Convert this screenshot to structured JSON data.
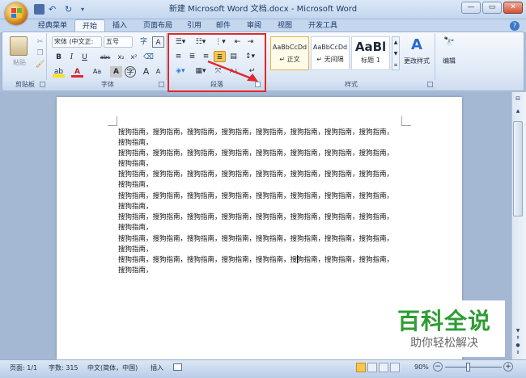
{
  "window": {
    "title": "新建 Microsoft Word 文档.docx - Microsoft Word",
    "minimize": "—",
    "maximize": "▭",
    "close": "✕"
  },
  "tabs": [
    "经典菜单",
    "开始",
    "插入",
    "页面布局",
    "引用",
    "邮件",
    "审阅",
    "视图",
    "开发工具"
  ],
  "active_tab": "开始",
  "ribbon": {
    "clipboard": {
      "paste_label": "粘贴",
      "group_label": "剪贴板"
    },
    "font": {
      "font_name": "宋体 (中文正:",
      "font_size": "五号",
      "group_label": "字体",
      "bold": "B",
      "italic": "I",
      "underline": "U",
      "strike": "abc",
      "subscript": "x₂",
      "superscript": "x²",
      "aa": "Aa",
      "grow": "A",
      "shrink": "A"
    },
    "paragraph": {
      "group_label": "段落"
    },
    "styles": {
      "group_label": "样式",
      "items": [
        {
          "preview": "AaBbCcDd",
          "name": "↵ 正文"
        },
        {
          "preview": "AaBbCcDd",
          "name": "↵ 无间隔"
        },
        {
          "preview": "AaBl",
          "name": "标题 1"
        }
      ],
      "change_styles": "更改样式"
    },
    "editing": {
      "label": "编辑"
    }
  },
  "document": {
    "lines": [
      "搜狗指南，搜狗指南，搜狗指南，搜狗指南，搜狗指南，搜狗指南，搜狗指南，搜狗指南，",
      "搜狗指南，",
      "搜狗指南，搜狗指南，搜狗指南，搜狗指南，搜狗指南，搜狗指南，搜狗指南，搜狗指南，",
      "搜狗指南，",
      "搜狗指南，搜狗指南，搜狗指南，搜狗指南，搜狗指南，搜狗指南，搜狗指南，搜狗指南，",
      "搜狗指南，",
      "搜狗指南，搜狗指南，搜狗指南，搜狗指南，搜狗指南，搜狗指南，搜狗指南，搜狗指南，",
      "搜狗指南，",
      "搜狗指南，搜狗指南，搜狗指南，搜狗指南，搜狗指南，搜狗指南，搜狗指南，搜狗指南，",
      "搜狗指南，",
      "搜狗指南，搜狗指南，搜狗指南，搜狗指南，搜狗指南，搜狗指南，搜狗指南，搜狗指南，",
      "搜狗指南，",
      "搜狗指南，搜狗指南，搜狗指南，搜狗指南，搜狗指南，搜狗指南，搜狗指南，搜狗指南，",
      "搜狗指南，"
    ]
  },
  "status": {
    "page": "页面: 1/1",
    "words": "字数: 315",
    "language": "中文(简体，中国)",
    "mode": "插入",
    "zoom": "90%"
  },
  "watermark": {
    "title": "百科全说",
    "subtitle": "助你轻松解决"
  },
  "colors": {
    "highlight": "#e0282a",
    "accent": "#f7c850",
    "watermark_green": "#2e9d34"
  }
}
